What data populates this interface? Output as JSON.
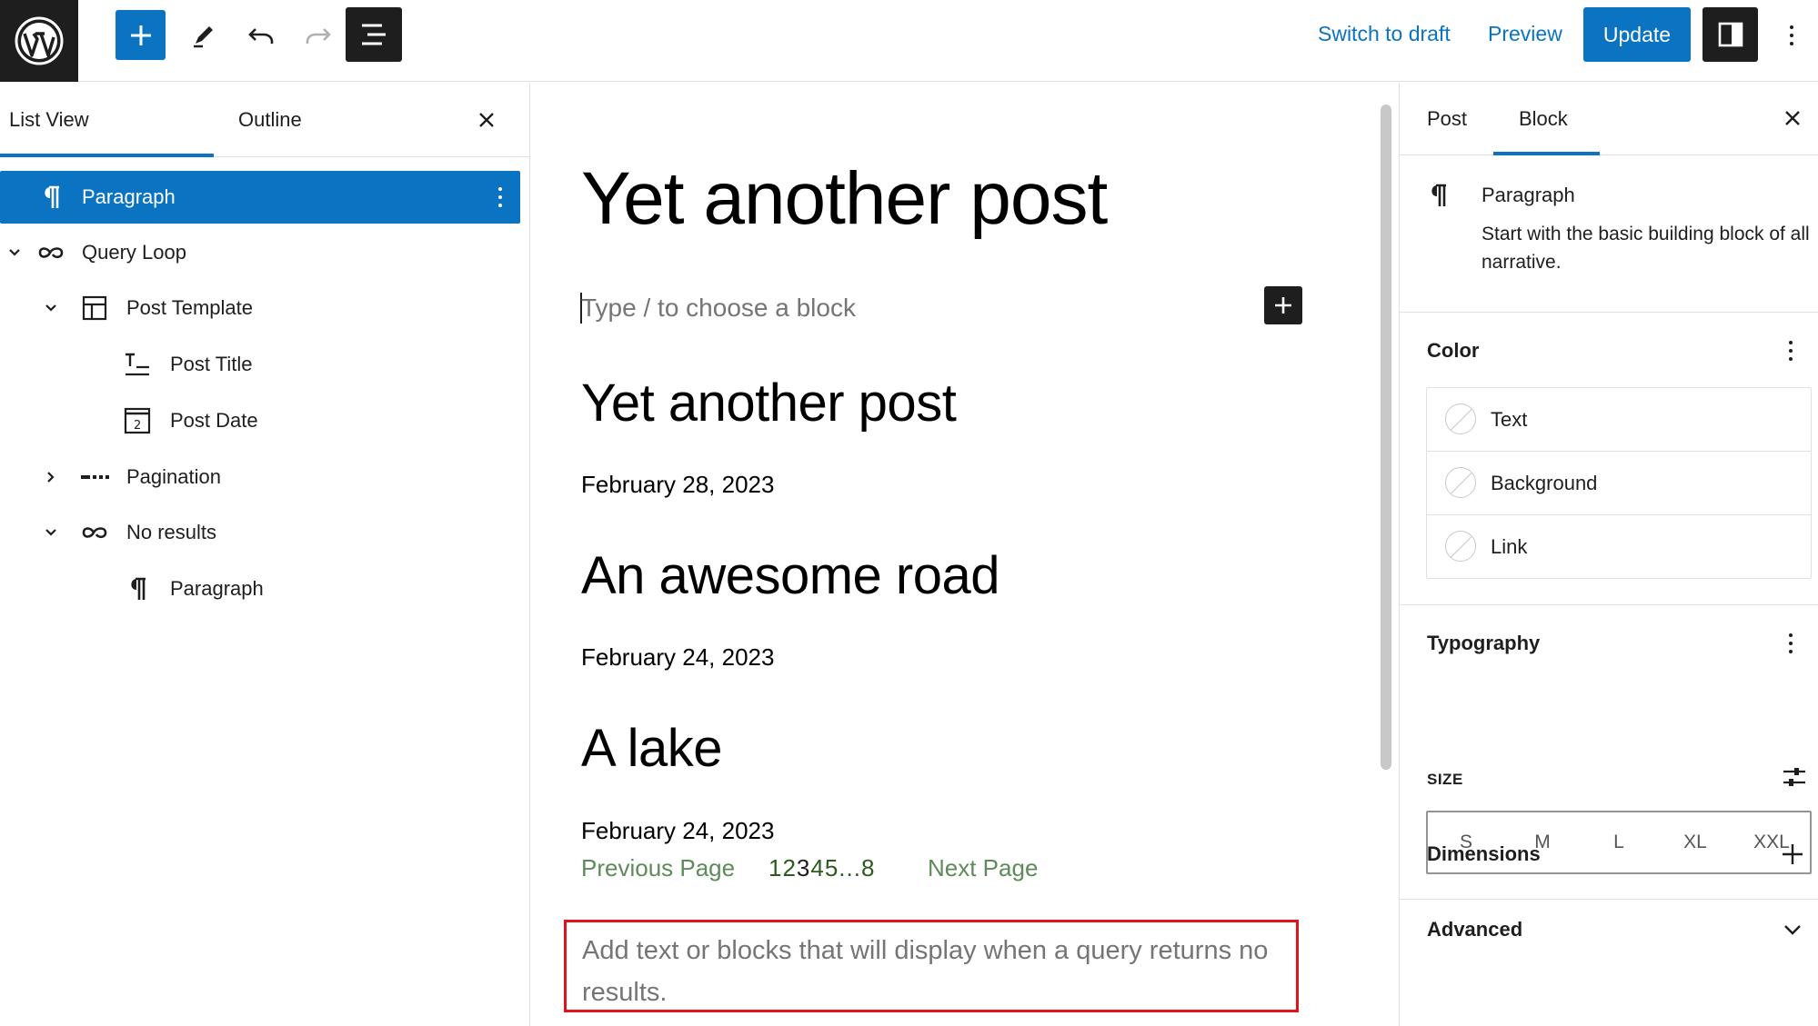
{
  "topbar": {
    "switch_draft": "Switch to draft",
    "preview": "Preview",
    "update": "Update"
  },
  "list_view": {
    "tabs": [
      "List View",
      "Outline"
    ],
    "items": [
      {
        "label": "Paragraph",
        "selected": true
      },
      {
        "label": "Query Loop"
      },
      {
        "label": "Post Template"
      },
      {
        "label": "Post Title"
      },
      {
        "label": "Post Date"
      },
      {
        "label": "Pagination"
      },
      {
        "label": "No results"
      },
      {
        "label": "Paragraph"
      }
    ]
  },
  "editor": {
    "title": "Yet another post",
    "placeholder": "Type / to choose a block",
    "posts": [
      {
        "title": "Yet another post",
        "date": "February 28, 2023"
      },
      {
        "title": "An awesome road",
        "date": "February 24, 2023"
      },
      {
        "title": "A lake",
        "date": "February 24, 2023"
      }
    ],
    "pagination": {
      "previous": "Previous Page",
      "numbers_before": "12",
      "current": "3",
      "numbers_after": "45...8",
      "next": "Next Page"
    },
    "no_results_text": "Add text or blocks that will display when a query returns no results."
  },
  "sidebar": {
    "tabs": [
      "Post",
      "Block"
    ],
    "block": {
      "name": "Paragraph",
      "description": "Start with the basic building block of all narrative."
    },
    "color": {
      "title": "Color",
      "items": [
        "Text",
        "Background",
        "Link"
      ]
    },
    "typography": {
      "title": "Typography",
      "size_label": "SIZE",
      "sizes": [
        "S",
        "M",
        "L",
        "XL",
        "XXL"
      ]
    },
    "dimensions": "Dimensions",
    "advanced": "Advanced"
  },
  "colors": {
    "accent": "#0a73c2",
    "dark": "#1e1e1e",
    "highlight_border": "#e0131a",
    "pagination_link": "#5e8b5a"
  }
}
